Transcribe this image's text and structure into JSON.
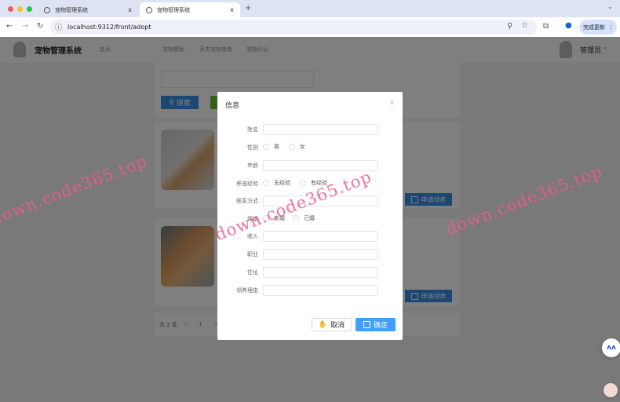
{
  "browser": {
    "tabs": [
      {
        "title": "宠物管理系统"
      },
      {
        "title": "宠物管理系统"
      }
    ],
    "tab_close": "x",
    "new_tab": "+",
    "url": "localhost:9312/front/adopt",
    "update_label": "完成更新"
  },
  "nav": {
    "title": "宠物管理系统",
    "items": [
      "首页",
      "宠物救助",
      "丢失宠物查看",
      "宠物论坛"
    ],
    "user": "管理员"
  },
  "search": {
    "button": "搜索"
  },
  "cards": [
    {
      "apply": "申请领养"
    },
    {
      "apply": "申请领养"
    }
  ],
  "pagination": {
    "total": "共 2 条",
    "prev": "<",
    "page": "1",
    "next": ">"
  },
  "modal": {
    "title": "信息",
    "close": "×",
    "fields": {
      "name": "姓名",
      "gender": "性别",
      "age": "年龄",
      "experience": "养宠经验",
      "contact": "联系方式",
      "marriage": "婚姻",
      "income": "收入",
      "job": "职业",
      "address": "住址",
      "reason": "领养理由"
    },
    "gender_options": [
      "男",
      "女"
    ],
    "experience_options": [
      "无经验",
      "有经验"
    ],
    "marriage_options": [
      "未婚",
      "已婚"
    ],
    "cancel": "取消",
    "confirm": "确定"
  },
  "watermark": "down.code365.top",
  "colors": {
    "primary": "#3a8ee6",
    "confirm": "#409eff",
    "watermark": "#f05a8c"
  }
}
